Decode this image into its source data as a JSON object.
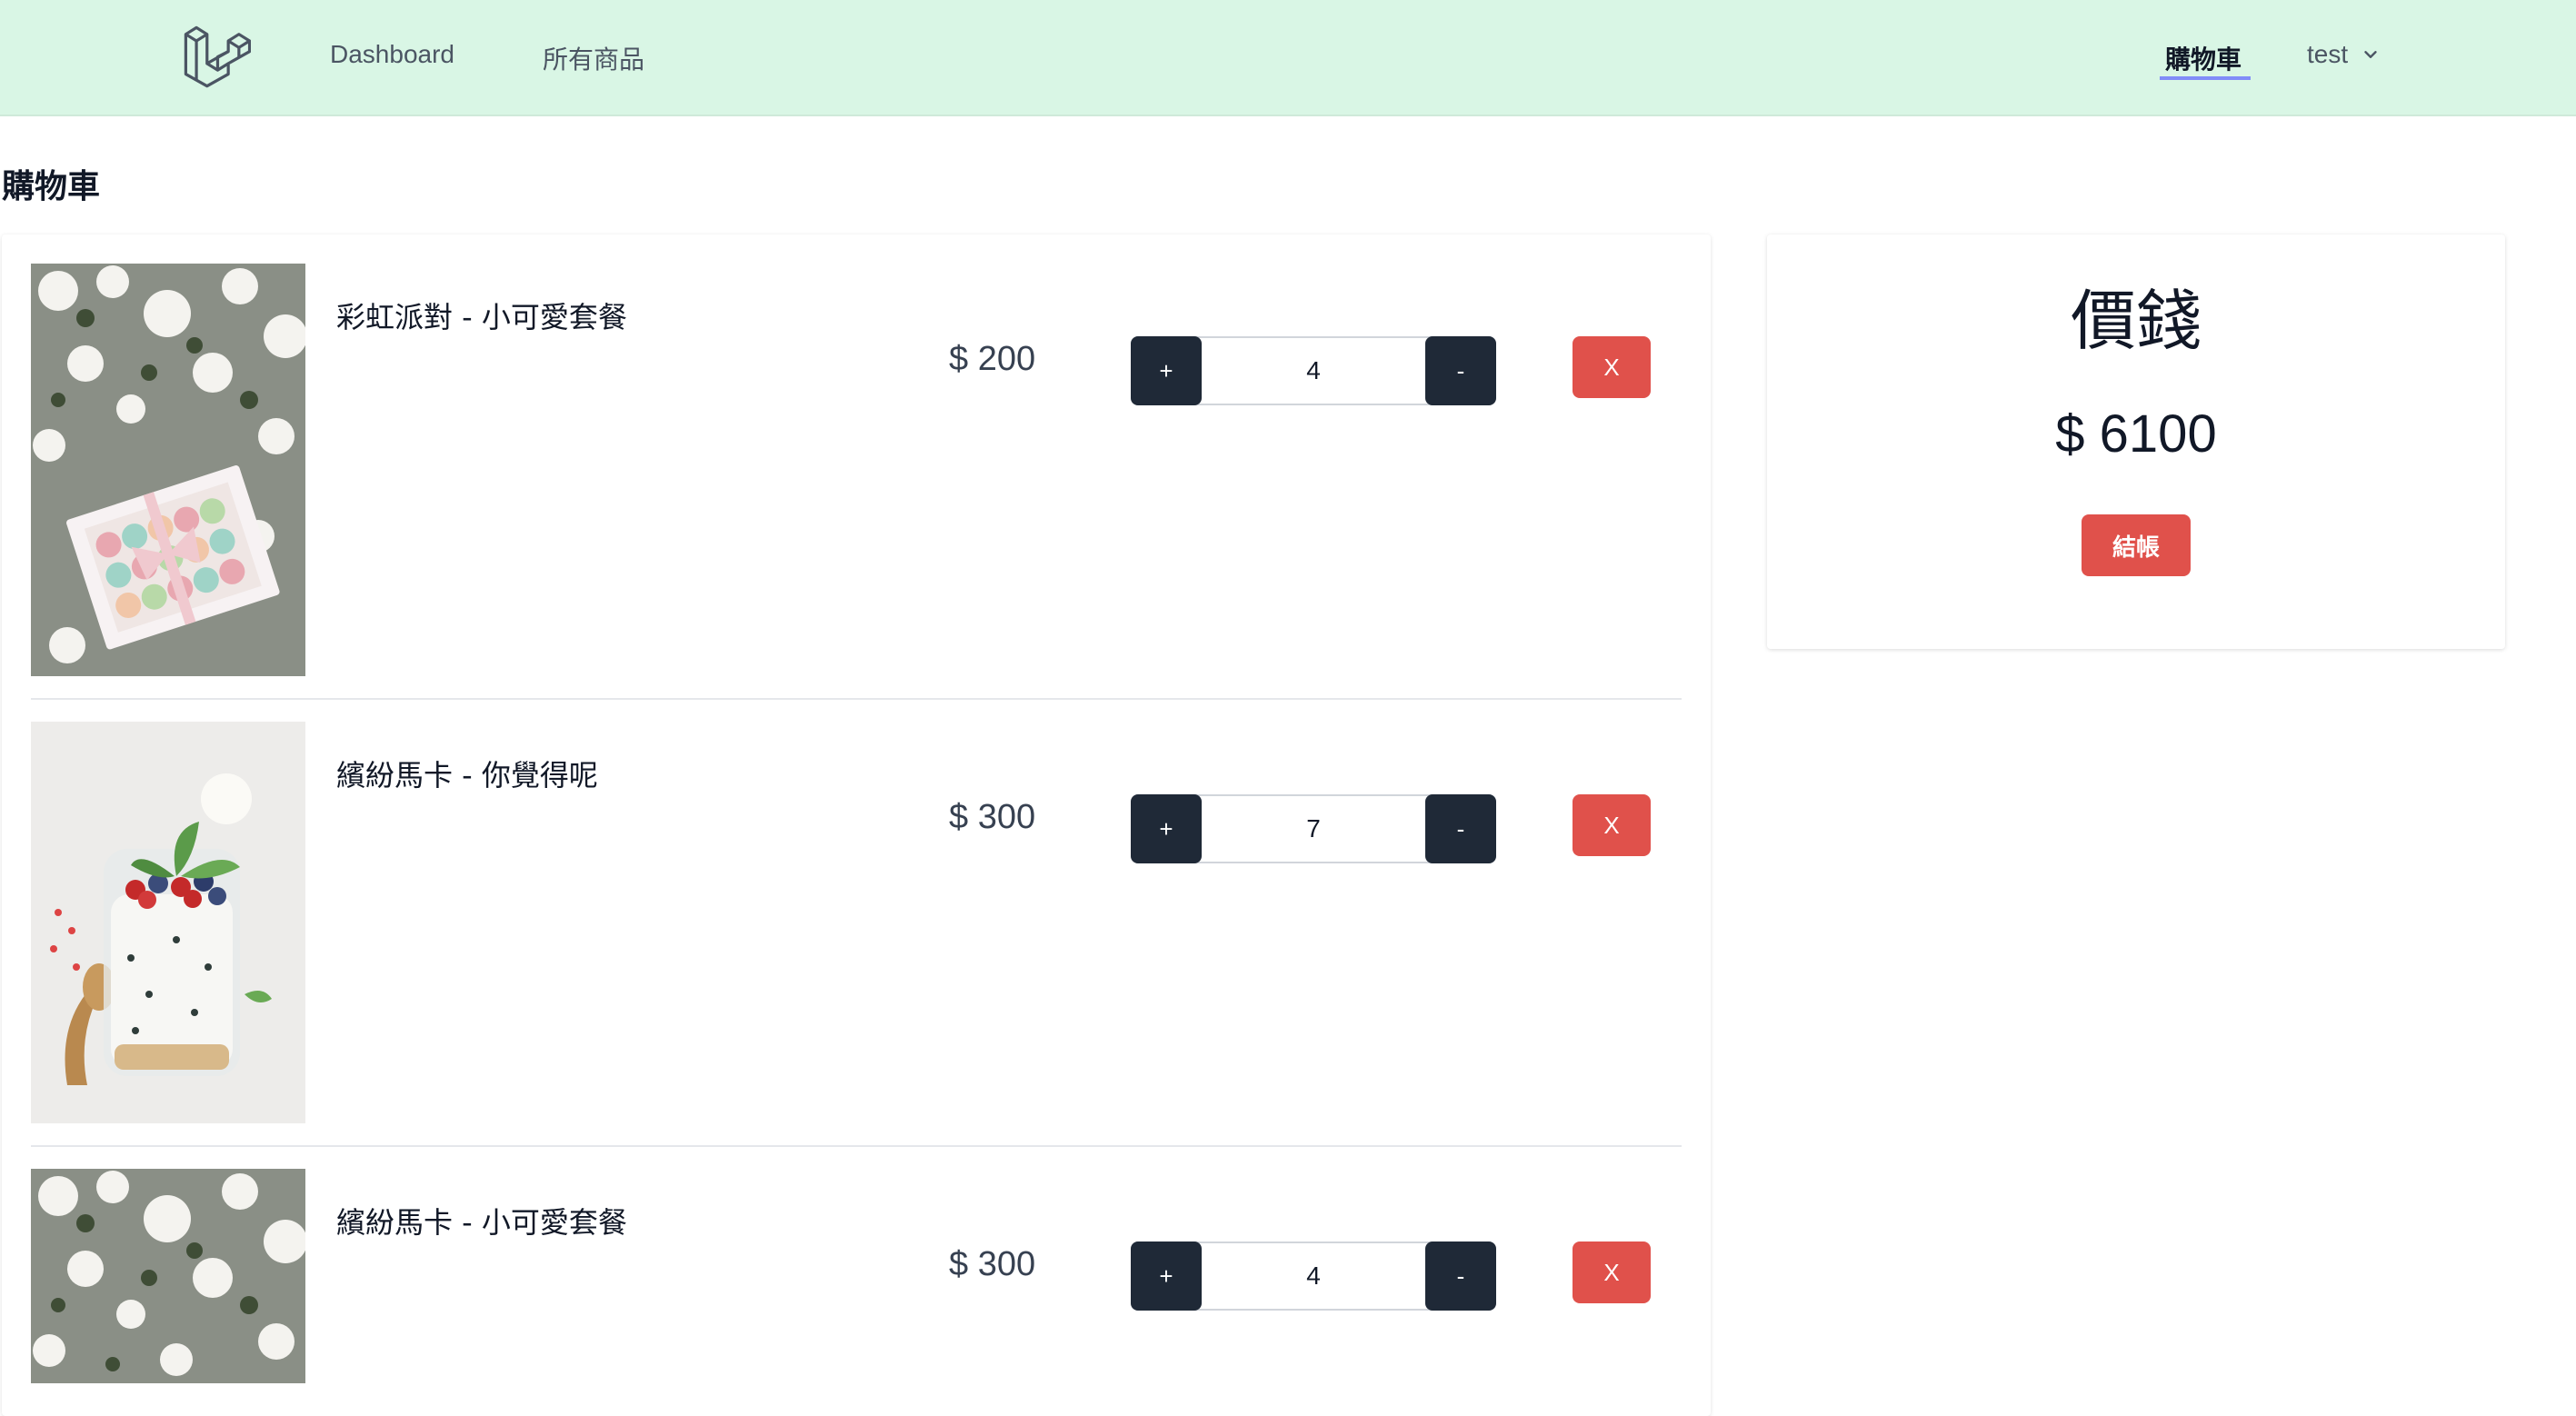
{
  "navbar": {
    "logo_icon": "laravel-logo-icon",
    "links": [
      {
        "label": "Dashboard"
      },
      {
        "label": "所有商品"
      }
    ],
    "cart_label": "購物車",
    "user": {
      "name": "test",
      "icon": "chevron-down-icon"
    }
  },
  "page": {
    "title": "購物車"
  },
  "cart": {
    "items": [
      {
        "name": "彩虹派對 - 小可愛套餐",
        "price": "$ 200",
        "quantity": "4",
        "plus_label": "+",
        "minus_label": "-",
        "remove_label": "X",
        "image": "macaron-box-flowers-image"
      },
      {
        "name": "繽紛馬卡 - 你覺得呢",
        "price": "$ 300",
        "quantity": "7",
        "plus_label": "+",
        "minus_label": "-",
        "remove_label": "X",
        "image": "yogurt-berries-jar-image"
      },
      {
        "name": "繽紛馬卡 - 小可愛套餐",
        "price": "$ 300",
        "quantity": "4",
        "plus_label": "+",
        "minus_label": "-",
        "remove_label": "X",
        "image": "macaron-box-flowers-image"
      }
    ]
  },
  "summary": {
    "title": "價錢",
    "total": "$ 6100",
    "checkout_label": "結帳"
  },
  "colors": {
    "navbar_bg": "#d9f6e5",
    "dark_button": "#1f2937",
    "danger": "#e0514b",
    "active_underline": "#818cf8"
  }
}
